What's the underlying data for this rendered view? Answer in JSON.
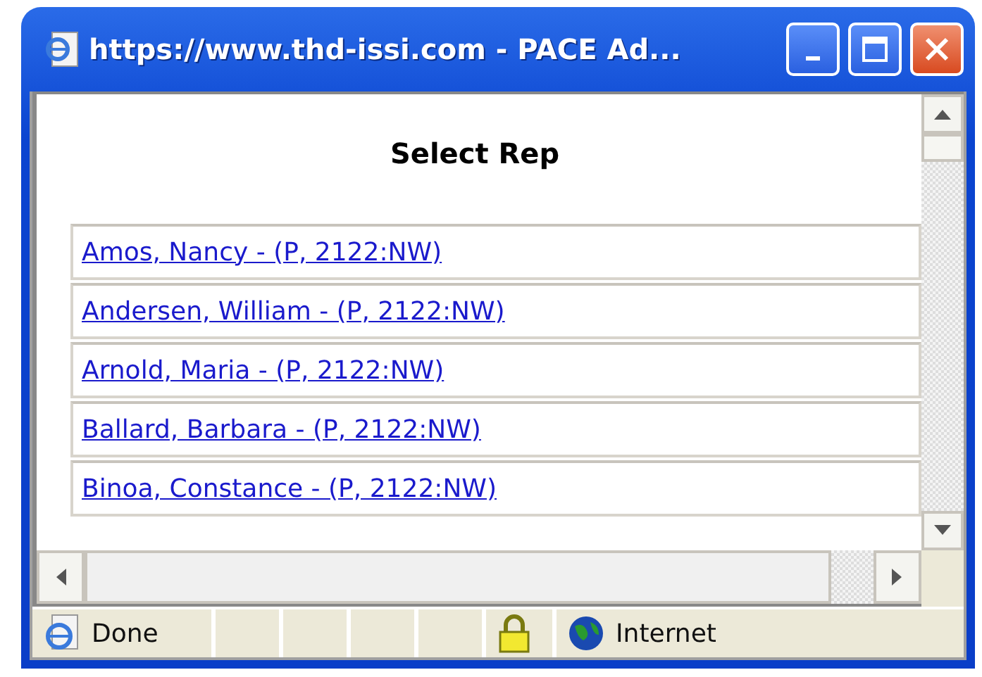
{
  "window": {
    "title": "https://www.thd-issi.com - PACE Ad..."
  },
  "heading": "Select Rep",
  "reps": [
    {
      "label": "Amos, Nancy - (P, 2122:NW)"
    },
    {
      "label": "Andersen, William - (P, 2122:NW)"
    },
    {
      "label": "Arnold, Maria - (P, 2122:NW)"
    },
    {
      "label": "Ballard, Barbara - (P, 2122:NW)"
    },
    {
      "label": "Binoa, Constance - (P, 2122:NW)"
    }
  ],
  "status_bar": {
    "text": "Done",
    "secure": true,
    "zone": "Internet"
  }
}
